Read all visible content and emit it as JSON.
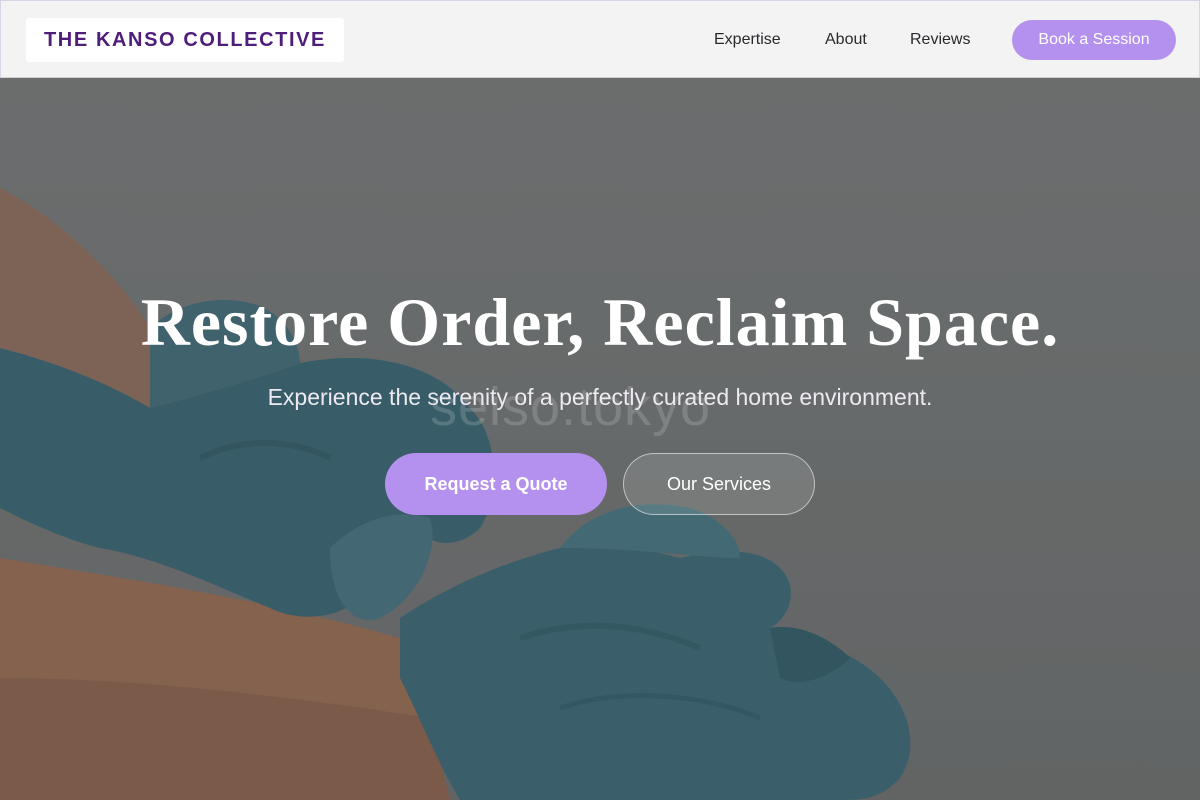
{
  "brand": {
    "name": "THE KANSO COLLECTIVE"
  },
  "nav": {
    "links": [
      "Expertise",
      "About",
      "Reviews"
    ],
    "cta_label": "Book a Session"
  },
  "hero": {
    "title": "Restore Order, Reclaim Space.",
    "subtitle": "Experience the serenity of a perfectly curated home environment.",
    "watermark": "seiso.tokyo",
    "primary_label": "Request a Quote",
    "secondary_label": "Our Services",
    "image": "gloved-hands-photo"
  },
  "colors": {
    "accent": "#b491ee",
    "brand_text": "#4f1d7a",
    "header_bg": "#f3f3f4",
    "glove": "#3e6b76",
    "skin": "#a27558"
  }
}
